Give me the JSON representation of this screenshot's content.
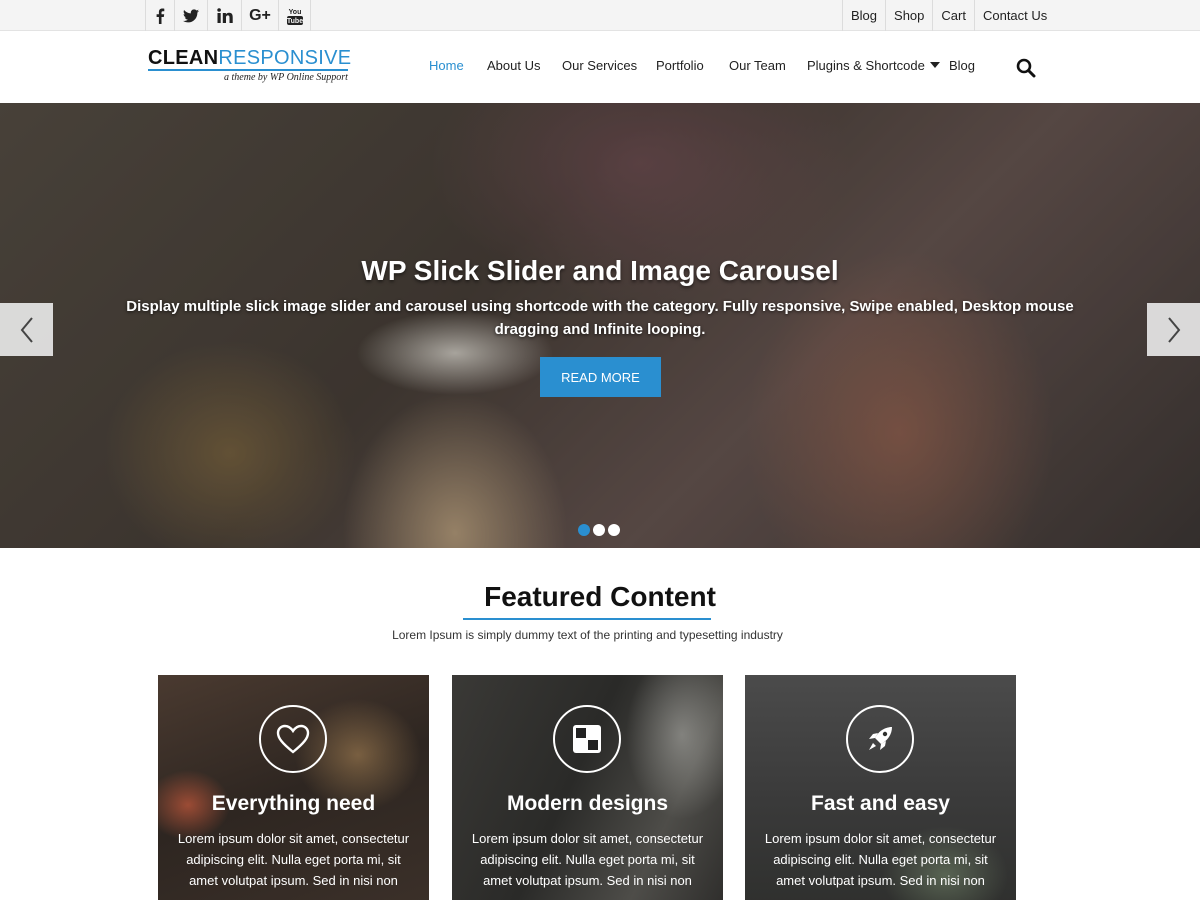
{
  "topbar": {
    "social": [
      {
        "icon": "facebook-icon",
        "glyph": "f"
      },
      {
        "icon": "twitter-icon",
        "glyph": "t"
      },
      {
        "icon": "linkedin-icon",
        "glyph": "in"
      },
      {
        "icon": "google-plus-icon",
        "glyph": "G+"
      },
      {
        "icon": "youtube-icon",
        "glyph": "You Tube"
      }
    ],
    "links": [
      "Blog",
      "Shop",
      "Cart",
      "Contact Us"
    ]
  },
  "header": {
    "logo_part1": "CLEAN",
    "logo_part2": "RESPONSIVE",
    "logo_tagline": "a theme by WP Online Support",
    "nav": [
      "Home",
      "About Us",
      "Our Services",
      "Portfolio",
      "Our Team",
      "Plugins & Shortcode",
      "Blog"
    ],
    "active_index": 0
  },
  "hero": {
    "title": "WP Slick Slider and Image Carousel",
    "description": "Display multiple slick image slider and carousel using shortcode with the category. Fully responsive, Swipe enabled, Desktop mouse dragging and Infinite looping.",
    "button": "READ MORE",
    "slide_count": 3,
    "active_slide": 0
  },
  "featured": {
    "title": "Featured Content",
    "subtitle": "Lorem Ipsum is simply dummy text of the printing and typesetting industry",
    "cards": [
      {
        "icon": "heart-icon",
        "title": "Everything need",
        "text": "Lorem ipsum dolor sit amet, consectetur adipiscing elit. Nulla eget porta mi, sit amet volutpat ipsum. Sed in nisi non"
      },
      {
        "icon": "grid-squares-icon",
        "title": "Modern designs",
        "text": "Lorem ipsum dolor sit amet, consectetur adipiscing elit. Nulla eget porta mi, sit amet volutpat ipsum. Sed in nisi non"
      },
      {
        "icon": "rocket-icon",
        "title": "Fast and easy",
        "text": "Lorem ipsum dolor sit amet, consectetur adipiscing elit. Nulla eget porta mi, sit amet volutpat ipsum. Sed in nisi non"
      }
    ]
  },
  "colors": {
    "accent": "#2a8fd0",
    "text": "#222222",
    "topbar_bg": "#f4f4f4"
  }
}
